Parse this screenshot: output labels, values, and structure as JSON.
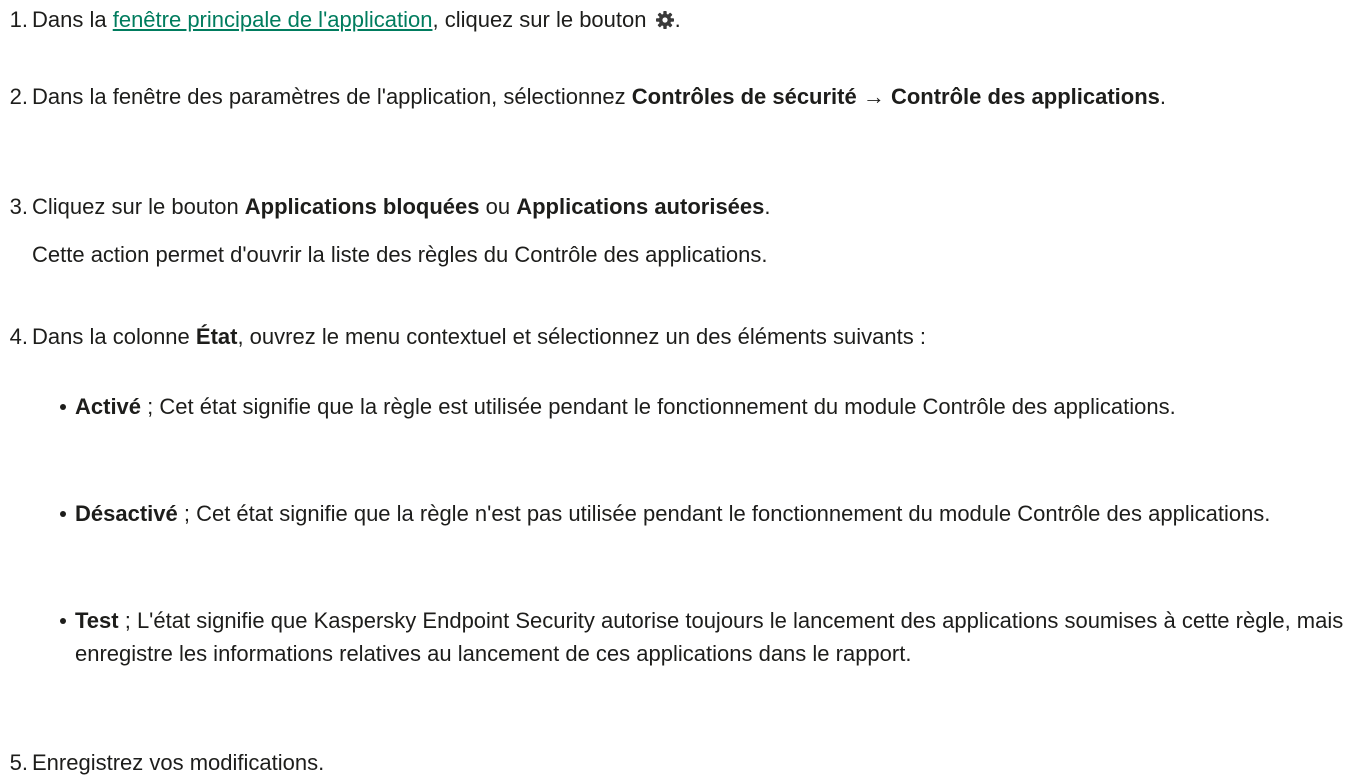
{
  "steps": [
    {
      "number": "1.",
      "before_link": "Dans la ",
      "link": "fenêtre principale de l'application",
      "after_link": ", cliquez sur le bouton ",
      "icon": "gear-icon",
      "end": "."
    },
    {
      "number": "2.",
      "text1": "Dans la fenêtre des paramètres de l'application, sélectionnez ",
      "bold1": "Contrôles de sécurité → Contrôle des applications",
      "end": "."
    },
    {
      "number": "3.",
      "text1": "Cliquez sur le bouton ",
      "bold1": "Applications bloquées",
      "text2": " ou ",
      "bold2": "Applications autorisées",
      "end": ".",
      "note": "Cette action permet d'ouvrir la liste des règles du Contrôle des applications."
    },
    {
      "number": "4.",
      "text1": "Dans la colonne ",
      "bold1": "État",
      "text2": ", ouvrez le menu contextuel et sélectionnez un des éléments suivants :",
      "items": [
        {
          "term": "Activé",
          "desc": " ; Cet état signifie que la règle est utilisée pendant le fonctionnement du module Contrôle des applications."
        },
        {
          "term": "Désactivé",
          "desc": " ; Cet état signifie que la règle n'est pas utilisée pendant le fonctionnement du module Contrôle des applications."
        },
        {
          "term": "Test",
          "desc": " ; L'état signifie que Kaspersky Endpoint Security autorise toujours le lancement des applications soumises à cette règle, mais enregistre les informations relatives au lancement de ces applications dans le rapport."
        }
      ]
    },
    {
      "number": "5.",
      "text1": "Enregistrez vos modifications."
    }
  ],
  "colors": {
    "text": "#1d1d1b",
    "link": "#007c5e"
  }
}
